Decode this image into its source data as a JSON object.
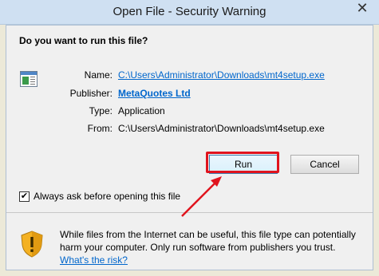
{
  "window": {
    "title": "Open File - Security Warning",
    "close_glyph": "✕"
  },
  "dialog": {
    "question": "Do you want to run this file?",
    "fields": {
      "name_label": "Name:",
      "name_value": "C:\\Users\\Administrator\\Downloads\\mt4setup.exe",
      "publisher_label": "Publisher:",
      "publisher_value": "MetaQuotes Ltd",
      "type_label": "Type:",
      "type_value": "Application",
      "from_label": "From:",
      "from_value": "C:\\Users\\Administrator\\Downloads\\mt4setup.exe"
    },
    "buttons": {
      "run_label": "Run",
      "cancel_label": "Cancel"
    },
    "checkbox": {
      "label": "Always ask before opening this file",
      "checked_glyph": "✔"
    },
    "warning": {
      "text": "While files from the Internet can be useful, this file type can potentially harm your computer. Only run software from publishers you trust.",
      "link": "What's the risk?"
    }
  },
  "annotation": {
    "highlight_color": "#e0141e"
  }
}
